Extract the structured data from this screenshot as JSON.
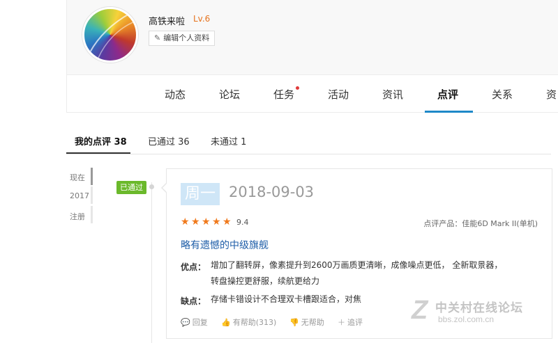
{
  "profile": {
    "username": "高铁来啦",
    "level": "Lv.6",
    "edit_label": "编辑个人资料",
    "edit_icon": "pencil-icon"
  },
  "nav_tabs": [
    {
      "label": "动态"
    },
    {
      "label": "论坛"
    },
    {
      "label": "任务",
      "has_dot": true
    },
    {
      "label": "活动"
    },
    {
      "label": "资讯"
    },
    {
      "label": "点评",
      "active": true
    },
    {
      "label": "关系"
    },
    {
      "label": "资"
    }
  ],
  "sub_tabs": {
    "mine": "我的点评 38",
    "passed": "已通过 36",
    "rejected": "未通过 1"
  },
  "timeline": {
    "items": [
      "现在",
      "2017",
      "注册"
    ],
    "badge": "已通过"
  },
  "review": {
    "weekday": "周一",
    "date": "2018-09-03",
    "rating": 4.7,
    "stars_filled": 5,
    "score": "9.4",
    "product": "点评产品：佳能6D Mark II(单机)",
    "title": "略有遗憾的中级旗舰",
    "pros_label": "优点：",
    "pros_line1": "增加了翻转屏，像素提升到2600万画质更清晰，成像噪点更低， 全新取景器，",
    "pros_line2": "转盘操控更舒服，续航更给力",
    "cons_label": "缺点：",
    "cons_text": "存储卡错设计不合理双卡槽跟适合，对焦",
    "actions": {
      "reply": "回复",
      "helpful": "有帮助(313)",
      "unhelpful": "无帮助",
      "follow": "追评"
    }
  },
  "watermark": {
    "logo": "Z",
    "name": "中关村在线论坛",
    "url": "bbs.zol.com.cn"
  },
  "colors": {
    "accent": "#1e88c8",
    "level": "#e6731e",
    "badge": "#6bb92b",
    "star": "#f07a1d",
    "title_link": "#1f5ea8"
  }
}
